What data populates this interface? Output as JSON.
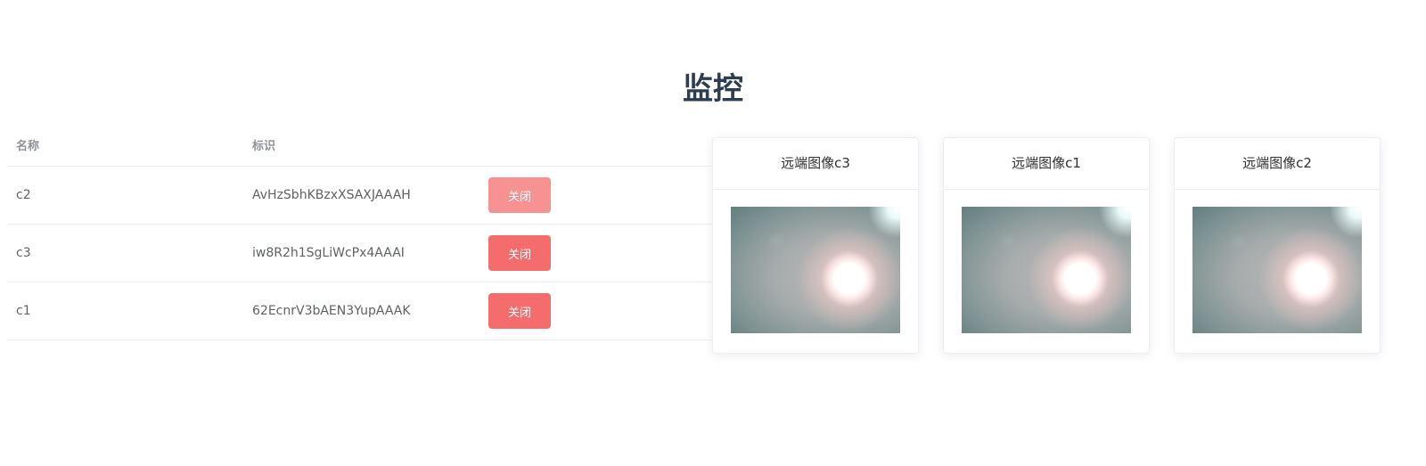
{
  "page": {
    "title": "监控"
  },
  "table": {
    "headers": {
      "name": "名称",
      "id": "标识",
      "action": ""
    },
    "rows": [
      {
        "name": "c2",
        "id": "AvHzSbhKBzxXSAXJAAAH",
        "button": "关闭",
        "button_state": "disabled"
      },
      {
        "name": "c3",
        "id": "iw8R2h1SgLiWcPx4AAAI",
        "button": "关闭",
        "button_state": "enabled"
      },
      {
        "name": "c1",
        "id": "62EcnrV3bAEN3YupAAAK",
        "button": "关闭",
        "button_state": "enabled"
      }
    ]
  },
  "cards": [
    {
      "title": "远端图像c3"
    },
    {
      "title": "远端图像c1"
    },
    {
      "title": "远端图像c2"
    }
  ],
  "colors": {
    "title": "#2c3e50",
    "danger": "#f56c6c",
    "border": "#ebeef5",
    "header_text": "#909399"
  }
}
